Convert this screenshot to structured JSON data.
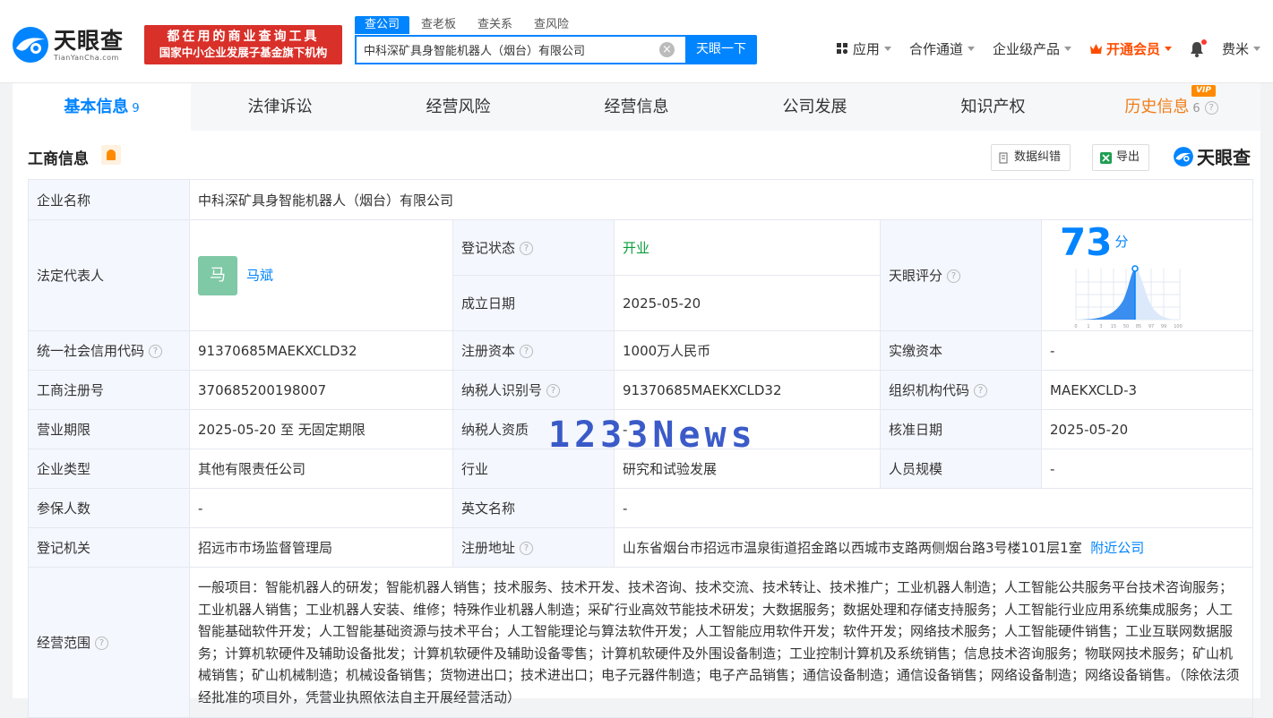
{
  "header": {
    "logo_cn": "天眼查",
    "logo_en": "TianYanCha.com",
    "slogan_line1": "都在用的商业查询工具",
    "slogan_line2": "国家中小企业发展子基金旗下机构",
    "search_tabs": [
      "查公司",
      "查老板",
      "查关系",
      "查风险"
    ],
    "search_value": "中科深矿具身智能机器人（烟台）有限公司",
    "search_button": "天眼一下",
    "nav": {
      "apps": "应用",
      "channel": "合作通道",
      "enterprise": "企业级产品",
      "vip": "开通会员",
      "user": "费米"
    }
  },
  "tabs": [
    {
      "label": "基本信息",
      "count": "9"
    },
    {
      "label": "法律诉讼",
      "count": ""
    },
    {
      "label": "经营风险",
      "count": ""
    },
    {
      "label": "经营信息",
      "count": ""
    },
    {
      "label": "公司发展",
      "count": ""
    },
    {
      "label": "知识产权",
      "count": ""
    },
    {
      "label": "历史信息",
      "count": "6",
      "badge": "VIP"
    }
  ],
  "section": {
    "title": "工商信息",
    "correct_btn": "数据纠错",
    "export_btn": "导出",
    "brand": "天眼查"
  },
  "info": {
    "name_label": "企业名称",
    "name": "中科深矿具身智能机器人（烟台）有限公司",
    "rep_label": "法定代表人",
    "rep_avatar": "马",
    "rep_name": "马斌",
    "status_label": "登记状态",
    "status": "开业",
    "est_label": "成立日期",
    "est": "2025-05-20",
    "score_label": "天眼评分",
    "score": "73",
    "score_unit": "分",
    "score_ticks": [
      "0",
      "1",
      "3",
      "15",
      "50",
      "85",
      "97",
      "99",
      "100"
    ],
    "credit_label": "统一社会信用代码",
    "credit": "91370685MAEKXCLD32",
    "capital_label": "注册资本",
    "capital": "1000万人民币",
    "paid_label": "实缴资本",
    "paid": "-",
    "regno_label": "工商注册号",
    "regno": "370685200198007",
    "taxid_label": "纳税人识别号",
    "taxid": "91370685MAEKXCLD32",
    "org_label": "组织机构代码",
    "org": "MAEKXCLD-3",
    "term_label": "营业期限",
    "term": "2025-05-20 至 无固定期限",
    "taxq_label": "纳税人资质",
    "taxq": "-",
    "approve_label": "核准日期",
    "approve": "2025-05-20",
    "type_label": "企业类型",
    "type": "其他有限责任公司",
    "industry_label": "行业",
    "industry": "研究和试验发展",
    "staff_label": "人员规模",
    "staff": "-",
    "insured_label": "参保人数",
    "insured": "-",
    "en_label": "英文名称",
    "en": "-",
    "authority_label": "登记机关",
    "authority": "招远市市场监督管理局",
    "addr_label": "注册地址",
    "addr": "山东省烟台市招远市温泉街道招金路以西城市支路两侧烟台路3号楼101层1室",
    "nearby": "附近公司",
    "scope_label": "经营范围",
    "scope": "一般项目：智能机器人的研发；智能机器人销售；技术服务、技术开发、技术咨询、技术交流、技术转让、技术推广；工业机器人制造；人工智能公共服务平台技术咨询服务；工业机器人销售；工业机器人安装、维修；特殊作业机器人制造；采矿行业高效节能技术研发；大数据服务；数据处理和存储支持服务；人工智能行业应用系统集成服务；人工智能基础软件开发；人工智能基础资源与技术平台；人工智能理论与算法软件开发；人工智能应用软件开发；软件开发；网络技术服务；人工智能硬件销售；工业互联网数据服务；计算机软硬件及辅助设备批发；计算机软硬件及辅助设备零售；计算机软硬件及外围设备制造；工业控制计算机及系统销售；信息技术咨询服务；物联网技术服务；矿山机械销售；矿山机械制造；机械设备销售；货物进出口；技术进出口；电子元器件制造；电子产品销售；通信设备制造；通信设备销售；网络设备制造；网络设备销售。（除依法须经批准的项目外，凭营业执照依法自主开展经营活动）"
  },
  "watermark": "1233News"
}
